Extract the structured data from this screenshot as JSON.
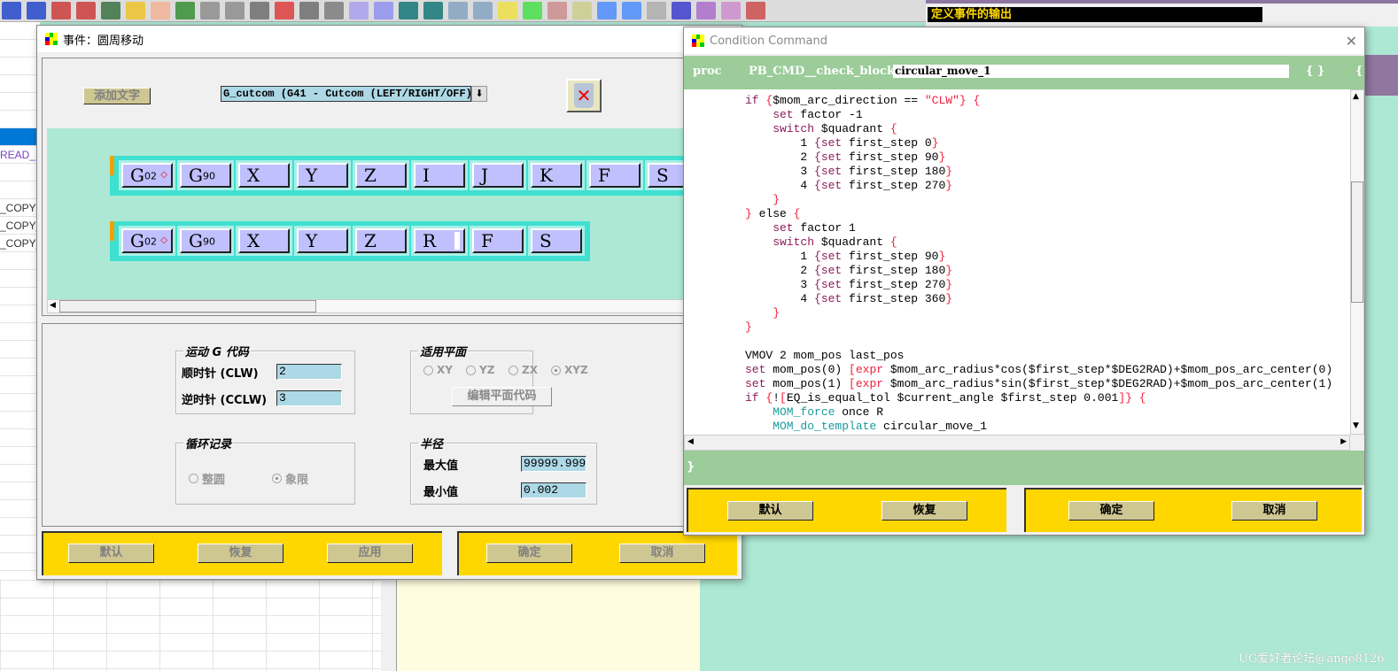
{
  "toolbar": {
    "icons": [
      "move-icon",
      "mirror-icon",
      "rotate-icon",
      "color-swatch-icon",
      "cube-icon",
      "xc-axis-icon",
      "pen-icon",
      "wireframe-icon",
      "point-icon",
      "cylinder-icon",
      "abs-axis-icon",
      "measure-icon",
      "list-icon",
      "arrow-left-icon",
      "arrow-right-icon",
      "back-icon",
      "forward-icon",
      "copy-left-icon",
      "copy-right-icon",
      "yellow-block-icon",
      "green-block-icon",
      "shape-icon",
      "erase-icon",
      "export-icon",
      "edit-icon",
      "face-icon",
      "pin-icon",
      "box-icon",
      "prism-icon",
      "rotate-view-icon",
      "wire-box-icon"
    ]
  },
  "output_bar": {
    "title": "定义事件的输出"
  },
  "sidebar": {
    "rows": [
      "",
      "",
      "",
      "",
      "",
      "",
      "",
      "READ_M",
      "",
      "",
      "_COPY",
      "_COPY_",
      "_COPY_",
      "",
      "",
      "",
      "",
      "",
      "",
      "",
      "",
      "",
      "",
      "",
      "",
      "",
      "",
      "",
      "",
      "",
      "",
      ""
    ],
    "selected_index": 6
  },
  "event_dialog": {
    "title": "事件：圆周移动",
    "add_text_label": "添加文字",
    "dropdown_value": "G_cutcom (G41 - Cutcom (LEFT/RIGHT/OFF))",
    "block_rows": [
      [
        {
          "main": "G",
          "sub": "02",
          "marker": true
        },
        {
          "main": "G",
          "sub": "90"
        },
        {
          "main": "X"
        },
        {
          "main": "Y"
        },
        {
          "main": "Z"
        },
        {
          "main": "I"
        },
        {
          "main": "J"
        },
        {
          "main": "K"
        },
        {
          "main": "F"
        },
        {
          "main": "S"
        }
      ],
      [
        {
          "main": "G",
          "sub": "02",
          "marker": true
        },
        {
          "main": "G",
          "sub": "90"
        },
        {
          "main": "X"
        },
        {
          "main": "Y"
        },
        {
          "main": "Z"
        },
        {
          "main": "R",
          "cursor": true
        },
        {
          "main": "F"
        },
        {
          "main": "S"
        }
      ]
    ],
    "motion_group": {
      "title": "运动 G 代码",
      "cw_label": "顺时针 (CLW)",
      "cw_value": "2",
      "ccw_label": "逆时针 (CCLW)",
      "ccw_value": "3"
    },
    "plane_group": {
      "title": "适用平面",
      "options": [
        "XY",
        "YZ",
        "ZX",
        "XYZ"
      ],
      "selected": "XYZ",
      "edit_button": "编辑平面代码"
    },
    "cycle_group": {
      "title": "循环记录",
      "options": [
        "整圆",
        "象限"
      ],
      "selected": "象限"
    },
    "radius_group": {
      "title": "半径",
      "max_label": "最大值",
      "max_value": "99999.999",
      "min_label": "最小值",
      "min_value": "0.002"
    },
    "buttons": {
      "default": "默认",
      "restore": "恢复",
      "apply": "应用",
      "ok": "确定",
      "cancel": "取消"
    }
  },
  "condition_dialog": {
    "title": "Condition Command",
    "proc_label": "proc",
    "proc_prefix": "PB_CMD__check_block_",
    "proc_name": "circular_move_1",
    "args": "{ }",
    "body_open": "{",
    "body_close": "}",
    "code_lines": [
      [
        [
          "if ",
          "k"
        ],
        [
          "{",
          "b"
        ],
        [
          "$mom_arc_direction == ",
          ""
        ],
        [
          "\"CLW\"} {",
          "b"
        ]
      ],
      [
        [
          "    set ",
          "k"
        ],
        [
          "factor -1",
          ""
        ]
      ],
      [
        [
          "    switch ",
          "k"
        ],
        [
          "$quadrant ",
          ""
        ],
        [
          "{",
          "b"
        ]
      ],
      [
        [
          "        1 ",
          ""
        ],
        [
          "{set ",
          "k"
        ],
        [
          "first_step 0",
          ""
        ],
        [
          "}",
          "b"
        ]
      ],
      [
        [
          "        2 ",
          ""
        ],
        [
          "{set ",
          "k"
        ],
        [
          "first_step 90",
          ""
        ],
        [
          "}",
          "b"
        ]
      ],
      [
        [
          "        3 ",
          ""
        ],
        [
          "{set ",
          "k"
        ],
        [
          "first_step 180",
          ""
        ],
        [
          "}",
          "b"
        ]
      ],
      [
        [
          "        4 ",
          ""
        ],
        [
          "{set ",
          "k"
        ],
        [
          "first_step 270",
          ""
        ],
        [
          "}",
          "b"
        ]
      ],
      [
        [
          "    }",
          "b"
        ]
      ],
      [
        [
          "} ",
          "b"
        ],
        [
          "else ",
          ""
        ],
        [
          "{",
          "b"
        ]
      ],
      [
        [
          "    set ",
          "k"
        ],
        [
          "factor 1",
          ""
        ]
      ],
      [
        [
          "    switch ",
          "k"
        ],
        [
          "$quadrant ",
          ""
        ],
        [
          "{",
          "b"
        ]
      ],
      [
        [
          "        1 ",
          ""
        ],
        [
          "{set ",
          "k"
        ],
        [
          "first_step 90",
          ""
        ],
        [
          "}",
          "b"
        ]
      ],
      [
        [
          "        2 ",
          ""
        ],
        [
          "{set ",
          "k"
        ],
        [
          "first_step 180",
          ""
        ],
        [
          "}",
          "b"
        ]
      ],
      [
        [
          "        3 ",
          ""
        ],
        [
          "{set ",
          "k"
        ],
        [
          "first_step 270",
          ""
        ],
        [
          "}",
          "b"
        ]
      ],
      [
        [
          "        4 ",
          ""
        ],
        [
          "{set ",
          "k"
        ],
        [
          "first_step 360",
          ""
        ],
        [
          "}",
          "b"
        ]
      ],
      [
        [
          "    }",
          "b"
        ]
      ],
      [
        [
          "}",
          "b"
        ]
      ],
      [
        [
          "",
          ""
        ]
      ],
      [
        [
          "VMOV 2 mom_pos last_pos",
          ""
        ]
      ],
      [
        [
          "set ",
          "k"
        ],
        [
          "mom_pos(0) ",
          ""
        ],
        [
          "[expr ",
          "b"
        ],
        [
          "$mom_arc_radius*cos($first_step*$DEG2RAD)+$mom_pos_arc_center(0)",
          ""
        ]
      ],
      [
        [
          "set ",
          "k"
        ],
        [
          "mom_pos(1) ",
          ""
        ],
        [
          "[expr ",
          "b"
        ],
        [
          "$mom_arc_radius*sin($first_step*$DEG2RAD)+$mom_pos_arc_center(1)",
          ""
        ]
      ],
      [
        [
          "if ",
          "k"
        ],
        [
          "{",
          "b"
        ],
        [
          "!",
          ""
        ],
        [
          "[",
          "b"
        ],
        [
          "EQ_is_equal_tol $current_angle $first_step 0.001",
          ""
        ],
        [
          "]} {",
          "b"
        ]
      ],
      [
        [
          "    MOM_force ",
          "m"
        ],
        [
          "once R",
          ""
        ]
      ],
      [
        [
          "    MOM_do_template ",
          "m"
        ],
        [
          "circular_move_1",
          ""
        ]
      ]
    ],
    "buttons": {
      "default": "默认",
      "restore": "恢复",
      "ok": "确定",
      "cancel": "取消"
    }
  },
  "watermark": "UG爱好者论坛@ange8126",
  "colors": {
    "mint": "#ade8d4",
    "teal": "#40e0d0",
    "block": "#c0c0ff",
    "yellow": "#ffd700",
    "green": "#9bcc99",
    "button": "#cfc792",
    "keyword": "#8b1a5a",
    "brace": "#f0203a",
    "mom": "#1a9a9a"
  }
}
